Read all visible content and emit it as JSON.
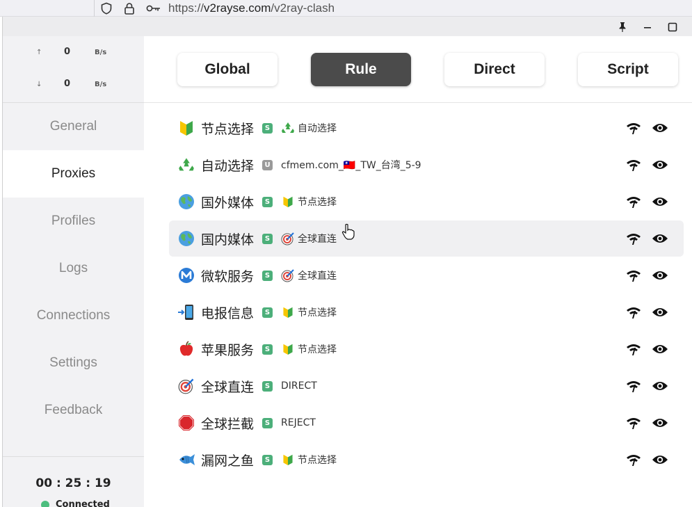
{
  "browser": {
    "url_prefix": "https://",
    "url_host": "v2rayse.com",
    "url_path": "/v2ray-clash"
  },
  "window": {
    "buttons": [
      "pin-icon",
      "minimize-icon",
      "maximize-icon"
    ]
  },
  "traffic": {
    "up_arrow": "↑",
    "up_value": "0",
    "up_unit": "B/s",
    "down_arrow": "↓",
    "down_value": "0",
    "down_unit": "B/s"
  },
  "nav": {
    "items": [
      {
        "label": "General"
      },
      {
        "label": "Proxies",
        "active": true
      },
      {
        "label": "Profiles"
      },
      {
        "label": "Logs"
      },
      {
        "label": "Connections"
      },
      {
        "label": "Settings"
      },
      {
        "label": "Feedback"
      }
    ]
  },
  "status": {
    "time": "00 : 25 : 19",
    "connection": "Connected",
    "connection_color": "#4cbe7e"
  },
  "modes": [
    {
      "label": "Global"
    },
    {
      "label": "Rule",
      "active": true
    },
    {
      "label": "Direct"
    },
    {
      "label": "Script"
    }
  ],
  "proxies": [
    {
      "icon": "beginner-icon",
      "name": "节点选择",
      "type": "S",
      "selected_icon": "recycle-icon",
      "selected": "自动选择"
    },
    {
      "icon": "recycle-icon",
      "name": "自动选择",
      "type": "U",
      "selected_icon": "",
      "selected": "cfmem.com_🇹🇼_TW_台湾_5-9"
    },
    {
      "icon": "globe-icon",
      "name": "国外媒体",
      "type": "S",
      "selected_icon": "beginner-icon",
      "selected": "节点选择"
    },
    {
      "icon": "globe-icon",
      "name": "国内媒体",
      "type": "S",
      "selected_icon": "target-icon",
      "selected": "全球直连",
      "hover": true
    },
    {
      "icon": "metro-m-icon",
      "name": "微软服务",
      "type": "S",
      "selected_icon": "target-icon",
      "selected": "全球直连"
    },
    {
      "icon": "phone-arrow-icon",
      "name": "电报信息",
      "type": "S",
      "selected_icon": "beginner-icon",
      "selected": "节点选择"
    },
    {
      "icon": "apple-icon",
      "name": "苹果服务",
      "type": "S",
      "selected_icon": "beginner-icon",
      "selected": "节点选择"
    },
    {
      "icon": "target-icon",
      "name": "全球直连",
      "type": "S",
      "selected_icon": "",
      "selected": "DIRECT"
    },
    {
      "icon": "stop-sign-icon",
      "name": "全球拦截",
      "type": "S",
      "selected_icon": "",
      "selected": "REJECT"
    },
    {
      "icon": "fish-icon",
      "name": "漏网之鱼",
      "type": "S",
      "selected_icon": "beginner-icon",
      "selected": "节点选择"
    }
  ],
  "row_actions": [
    "latency-test-icon",
    "eye-icon"
  ]
}
